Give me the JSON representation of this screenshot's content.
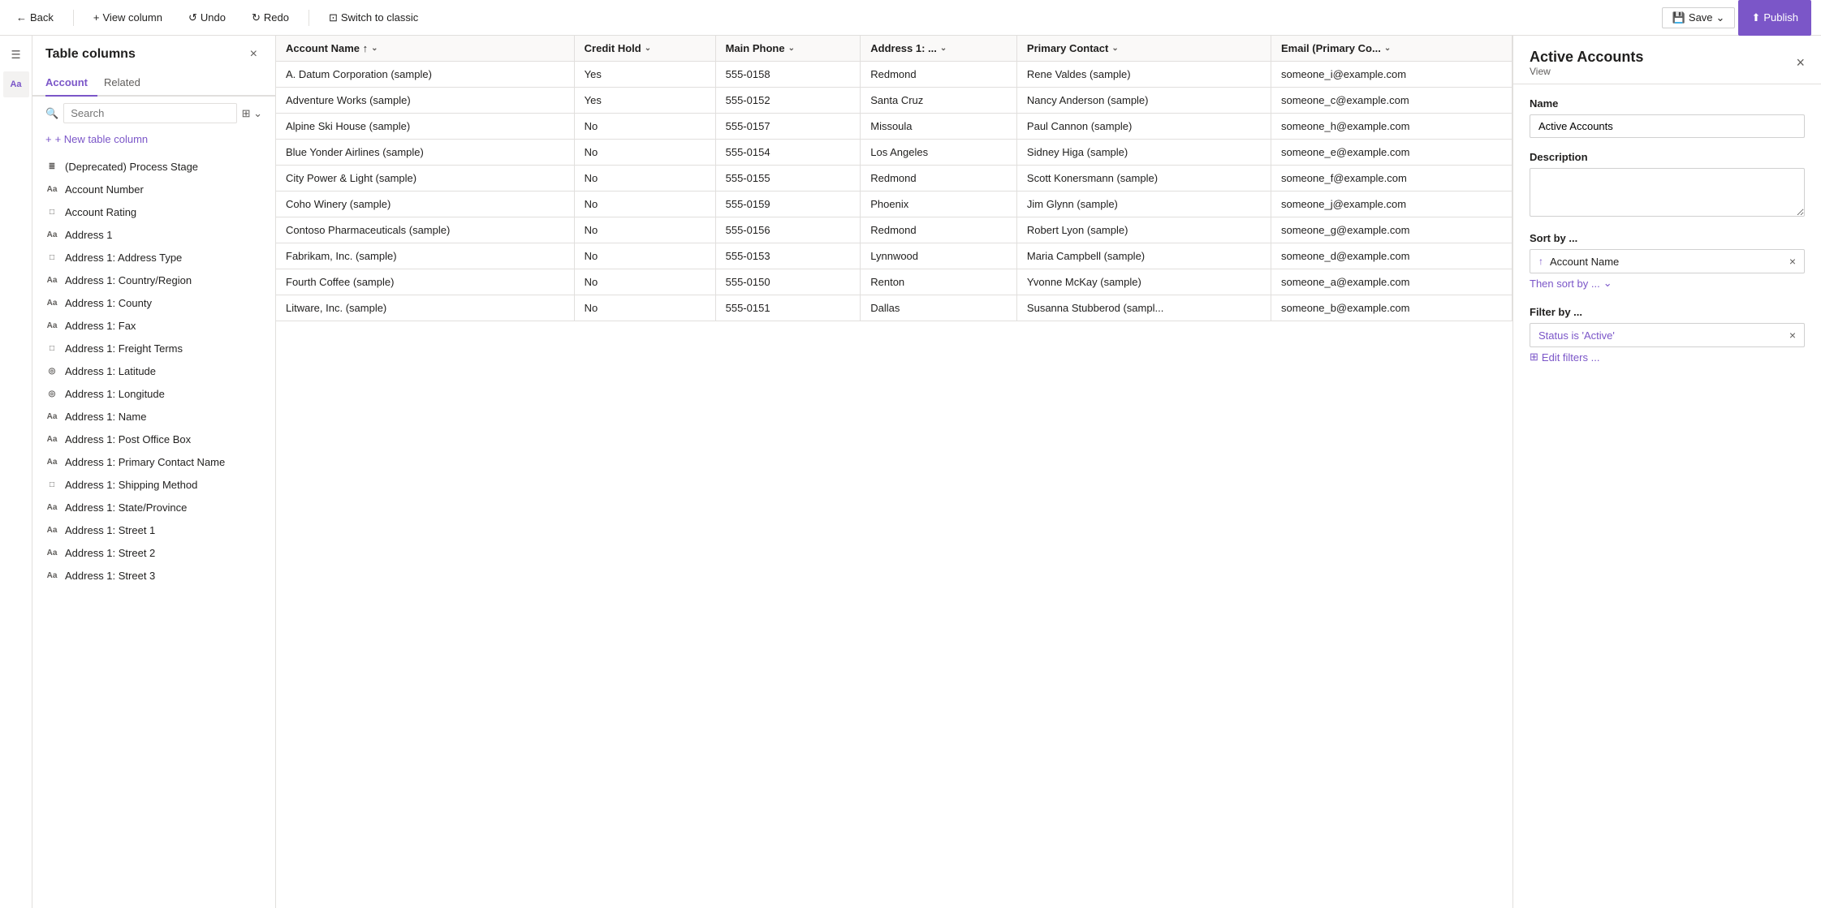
{
  "topbar": {
    "back_label": "Back",
    "view_column_label": "View column",
    "undo_label": "Undo",
    "redo_label": "Redo",
    "switch_label": "Switch to classic",
    "save_label": "Save",
    "publish_label": "Publish"
  },
  "sidebar": {
    "title": "Table columns",
    "close_label": "×",
    "tabs": [
      {
        "id": "account",
        "label": "Account",
        "active": true
      },
      {
        "id": "related",
        "label": "Related",
        "active": false
      }
    ],
    "search_placeholder": "Search",
    "new_column_label": "+ New table column",
    "items": [
      {
        "id": "deprecated-process-stage",
        "icon": "list",
        "label": "(Deprecated) Process Stage"
      },
      {
        "id": "account-number",
        "icon": "text",
        "label": "Account Number"
      },
      {
        "id": "account-rating",
        "icon": "box",
        "label": "Account Rating"
      },
      {
        "id": "address-1",
        "icon": "text",
        "label": "Address 1"
      },
      {
        "id": "address-1-address-type",
        "icon": "box",
        "label": "Address 1: Address Type"
      },
      {
        "id": "address-1-country-region",
        "icon": "abc",
        "label": "Address 1: Country/Region"
      },
      {
        "id": "address-1-county",
        "icon": "abc",
        "label": "Address 1: County"
      },
      {
        "id": "address-1-fax",
        "icon": "abc",
        "label": "Address 1: Fax"
      },
      {
        "id": "address-1-freight-terms",
        "icon": "box",
        "label": "Address 1: Freight Terms"
      },
      {
        "id": "address-1-latitude",
        "icon": "circle",
        "label": "Address 1: Latitude"
      },
      {
        "id": "address-1-longitude",
        "icon": "circle",
        "label": "Address 1: Longitude"
      },
      {
        "id": "address-1-name",
        "icon": "abc",
        "label": "Address 1: Name"
      },
      {
        "id": "address-1-post-office-box",
        "icon": "abc",
        "label": "Address 1: Post Office Box"
      },
      {
        "id": "address-1-primary-contact-name",
        "icon": "abc",
        "label": "Address 1: Primary Contact Name"
      },
      {
        "id": "address-1-shipping-method",
        "icon": "box",
        "label": "Address 1: Shipping Method"
      },
      {
        "id": "address-1-state-province",
        "icon": "abc",
        "label": "Address 1: State/Province"
      },
      {
        "id": "address-1-street-1",
        "icon": "abc",
        "label": "Address 1: Street 1"
      },
      {
        "id": "address-1-street-2",
        "icon": "abc",
        "label": "Address 1: Street 2"
      },
      {
        "id": "address-1-street-3",
        "icon": "abc",
        "label": "Address 1: Street 3"
      }
    ]
  },
  "table": {
    "columns": [
      {
        "id": "account-name",
        "label": "Account Name",
        "sortable": true,
        "sort": "asc"
      },
      {
        "id": "credit-hold",
        "label": "Credit Hold",
        "sortable": true
      },
      {
        "id": "main-phone",
        "label": "Main Phone",
        "sortable": true
      },
      {
        "id": "address-1",
        "label": "Address 1: ...",
        "sortable": true
      },
      {
        "id": "primary-contact",
        "label": "Primary Contact",
        "sortable": true
      },
      {
        "id": "email-primary",
        "label": "Email (Primary Co...",
        "sortable": true
      }
    ],
    "rows": [
      {
        "account_name": "A. Datum Corporation (sample)",
        "credit_hold": "Yes",
        "main_phone": "555-0158",
        "address_1": "Redmond",
        "primary_contact": "Rene Valdes (sample)",
        "email": "someone_i@example.com"
      },
      {
        "account_name": "Adventure Works (sample)",
        "credit_hold": "Yes",
        "main_phone": "555-0152",
        "address_1": "Santa Cruz",
        "primary_contact": "Nancy Anderson (sample)",
        "email": "someone_c@example.com"
      },
      {
        "account_name": "Alpine Ski House (sample)",
        "credit_hold": "No",
        "main_phone": "555-0157",
        "address_1": "Missoula",
        "primary_contact": "Paul Cannon (sample)",
        "email": "someone_h@example.com"
      },
      {
        "account_name": "Blue Yonder Airlines (sample)",
        "credit_hold": "No",
        "main_phone": "555-0154",
        "address_1": "Los Angeles",
        "primary_contact": "Sidney Higa (sample)",
        "email": "someone_e@example.com"
      },
      {
        "account_name": "City Power & Light (sample)",
        "credit_hold": "No",
        "main_phone": "555-0155",
        "address_1": "Redmond",
        "primary_contact": "Scott Konersmann (sample)",
        "email": "someone_f@example.com"
      },
      {
        "account_name": "Coho Winery (sample)",
        "credit_hold": "No",
        "main_phone": "555-0159",
        "address_1": "Phoenix",
        "primary_contact": "Jim Glynn (sample)",
        "email": "someone_j@example.com"
      },
      {
        "account_name": "Contoso Pharmaceuticals (sample)",
        "credit_hold": "No",
        "main_phone": "555-0156",
        "address_1": "Redmond",
        "primary_contact": "Robert Lyon (sample)",
        "email": "someone_g@example.com"
      },
      {
        "account_name": "Fabrikam, Inc. (sample)",
        "credit_hold": "No",
        "main_phone": "555-0153",
        "address_1": "Lynnwood",
        "primary_contact": "Maria Campbell (sample)",
        "email": "someone_d@example.com"
      },
      {
        "account_name": "Fourth Coffee (sample)",
        "credit_hold": "No",
        "main_phone": "555-0150",
        "address_1": "Renton",
        "primary_contact": "Yvonne McKay (sample)",
        "email": "someone_a@example.com"
      },
      {
        "account_name": "Litware, Inc. (sample)",
        "credit_hold": "No",
        "main_phone": "555-0151",
        "address_1": "Dallas",
        "primary_contact": "Susanna Stubberod (sampl...",
        "email": "someone_b@example.com"
      }
    ]
  },
  "right_panel": {
    "title": "Active Accounts",
    "view_label": "View",
    "close_label": "×",
    "name_label": "Name",
    "name_value": "Active Accounts",
    "description_label": "Description",
    "description_value": "",
    "sort_label": "Sort by ...",
    "sort_field": "Account Name",
    "sort_direction": "asc",
    "then_sort_label": "Then sort by ...",
    "filter_label": "Filter by ...",
    "filter_value": "Status is 'Active'",
    "edit_filters_label": "Edit filters ..."
  },
  "icons": {
    "back": "←",
    "undo": "↺",
    "redo": "↻",
    "switch": "⊡",
    "save": "💾",
    "chevron_down": "⌄",
    "publish": "⬆",
    "search": "🔍",
    "filter": "⊞",
    "close": "×",
    "sort_asc": "↑",
    "sort_desc": "↓",
    "plus": "+",
    "hamburger": "≡",
    "abc_icon": "Aa",
    "box_icon": "□",
    "list_icon": "≣",
    "circle_icon": "◎",
    "remove": "×",
    "then_sort_chevron": "⌄",
    "edit_filter": "⊞"
  }
}
